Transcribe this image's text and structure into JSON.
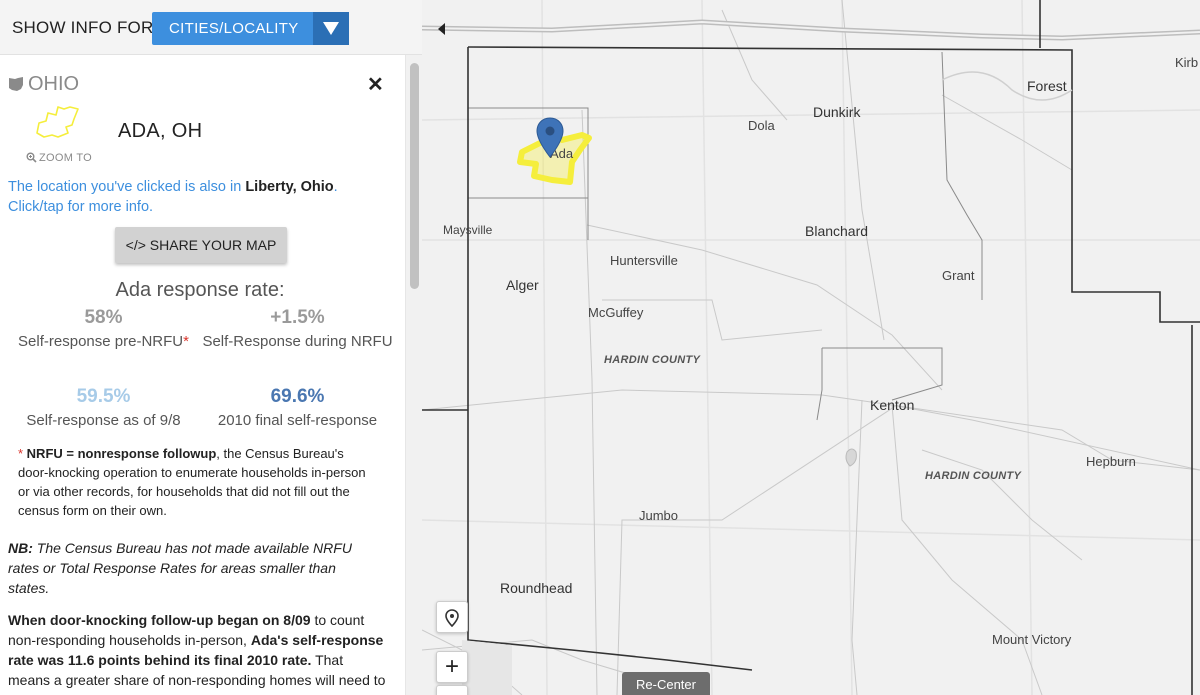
{
  "topbar": {
    "show_label": "SHOW INFO FOR:",
    "layer_value": "CITIES/LOCALITY"
  },
  "panel": {
    "state_name": "OHIO",
    "place_name": "ADA, OH",
    "zoom_to_label": "ZOOM TO",
    "also_in_prefix": "The location you've clicked is also in ",
    "also_in_place": "Liberty, Ohio",
    "also_in_suffix": ".",
    "click_more": "Click/tap for more info.",
    "share_button": "</> SHARE YOUR MAP",
    "rate_title": "Ada response rate:",
    "stats": [
      {
        "value": "58%",
        "label": "Self-response pre-NRFU",
        "asterisk": "*"
      },
      {
        "value": "+1.5%",
        "label": "Self-Response during NRFU"
      },
      {
        "value": "59.5%",
        "label": "Self-response as of 9/8"
      },
      {
        "value": "69.6%",
        "label": "2010 final self-response"
      }
    ],
    "nrfu_star": "* ",
    "nrfu_term": "NRFU = nonresponse followup",
    "nrfu_text": ", the Census Bureau's door-knocking operation to enumerate households in-person or via other records, for households that did not fill out the census form on their own.",
    "nb_lead": "NB:",
    "nb_text": " The Census Bureau has not made available NRFU rates or Total Response Rates for areas smaller than states.",
    "door_b1": "When door-knocking follow-up began on 8/09",
    "door_t1": " to count non-responding households in-person, ",
    "door_b2": "Ada's self-response rate was 11.6 points behind its final 2010 rate.",
    "door_t2": " That means a greater share of non-responding homes will need to be visited by census takers — an"
  },
  "map": {
    "labels": {
      "kirb": "Kirb",
      "forest": "Forest",
      "dunkirk": "Dunkirk",
      "dola": "Dola",
      "ada": "Ada",
      "maysville": "Maysville",
      "blanchard": "Blanchard",
      "huntersville": "Huntersville",
      "grant": "Grant",
      "alger": "Alger",
      "mcguffey": "McGuffey",
      "hardin1": "HARDIN COUNTY",
      "kenton": "Kenton",
      "hepburn": "Hepburn",
      "hardin2": "HARDIN COUNTY",
      "jumbo": "Jumbo",
      "roundhead": "Roundhead",
      "mount_victory": "Mount Victory"
    },
    "zoom_in": "+",
    "recenter_label": "Re-Center",
    "colors": {
      "place_highlight": "#f5ee3c",
      "pin": "#3e73b8",
      "select": "#3d8fde"
    }
  }
}
